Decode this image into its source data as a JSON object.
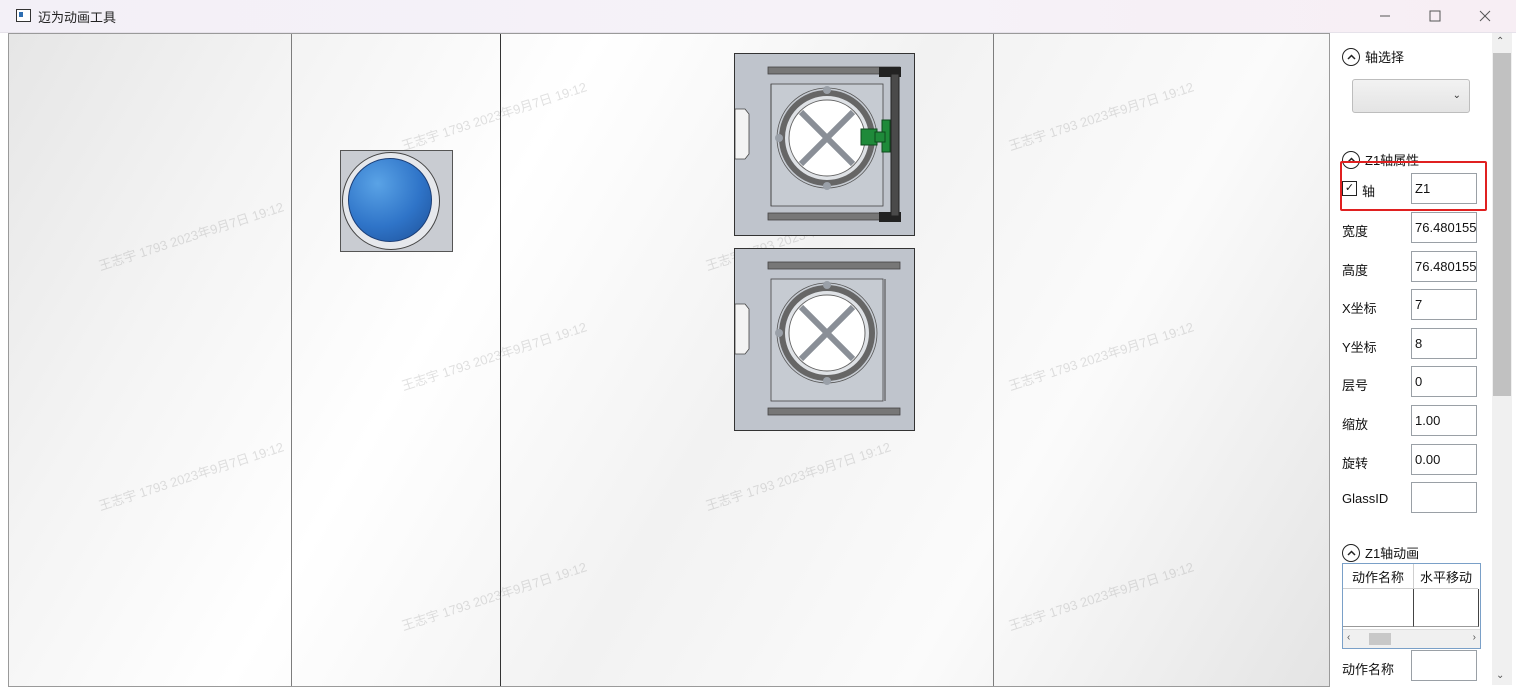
{
  "window": {
    "title": "迈为动画工具"
  },
  "watermark": "王志宇 1793 2023年9月7日 19:12",
  "panel": {
    "axis_select": {
      "label": "轴选择",
      "selected": ""
    },
    "properties": {
      "header": "Z1轴属性",
      "axis_label": "轴",
      "axis_checked": "✓",
      "axis_value": "Z1",
      "width_label": "宽度",
      "width_value": "76.480155",
      "height_label": "高度",
      "height_value": "76.480155",
      "x_label": "X坐标",
      "x_value": "7",
      "y_label": "Y坐标",
      "y_value": "8",
      "layer_label": "层号",
      "layer_value": "0",
      "scale_label": "缩放",
      "scale_value": "1.00",
      "rotate_label": "旋转",
      "rotate_value": "0.00",
      "glass_label": "GlassID",
      "glass_value": ""
    },
    "animation": {
      "header": "Z1轴动画",
      "columns": [
        "动作名称",
        "水平移动"
      ],
      "action_name_label": "动作名称",
      "action_name_value": ""
    }
  },
  "colors": {
    "highlight": "#e02020",
    "disk": "#2f74c8",
    "clamp": "#1f8a3a",
    "module": "#bfc4cc"
  }
}
